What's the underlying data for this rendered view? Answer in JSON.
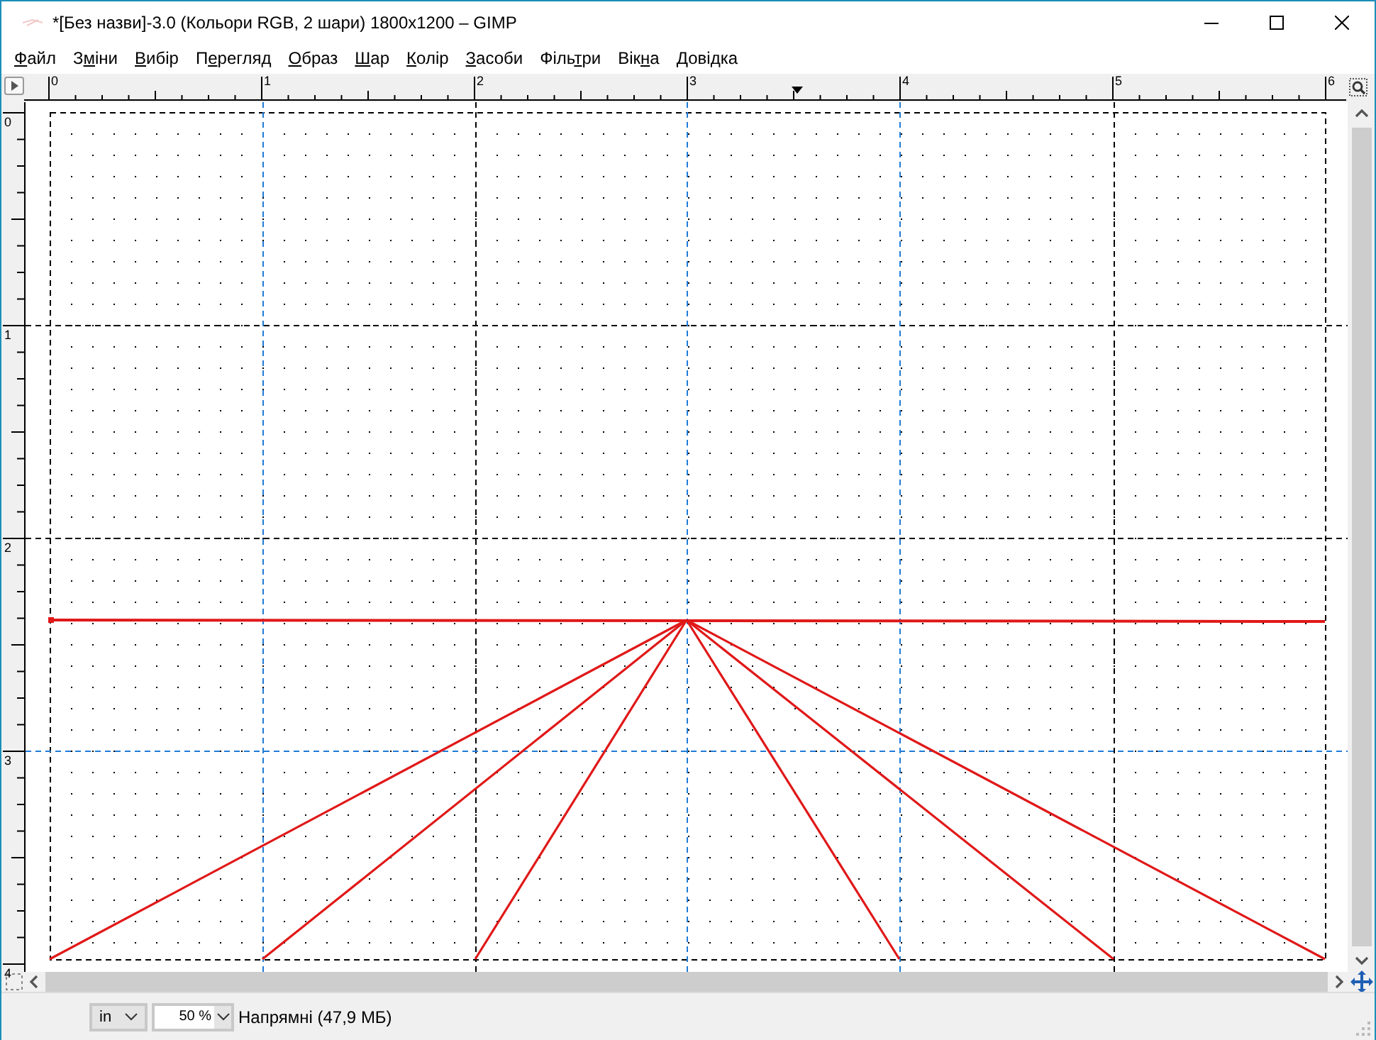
{
  "window": {
    "title": "*[Без назви]-3.0 (Кольори RGB, 2 шари) 1800x1200 – GIMP"
  },
  "menu": [
    {
      "key": "Ф",
      "post": "айл"
    },
    {
      "pre": "З",
      "key": "м",
      "post": "іни"
    },
    {
      "key": "В",
      "post": "ибір"
    },
    {
      "pre": "П",
      "key": "е",
      "post": "регляд"
    },
    {
      "key": "О",
      "post": "браз"
    },
    {
      "key": "Ш",
      "post": "ар"
    },
    {
      "key": "К",
      "post": "олір"
    },
    {
      "key": "З",
      "post": "асоби"
    },
    {
      "pre": "Філь",
      "key": "т",
      "post": "ри"
    },
    {
      "pre": "Вік",
      "key": "н",
      "post": "а"
    },
    {
      "key": "Д",
      "post": "овідка"
    }
  ],
  "top_ruler": {
    "labels": [
      "0",
      "1",
      "2",
      "3",
      "4",
      "5",
      "6"
    ]
  },
  "left_ruler": {
    "labels": [
      "0",
      "1",
      "2",
      "3",
      "4"
    ]
  },
  "status_bar": {
    "unit": "in",
    "zoom": "50 %",
    "message": "Напрямні (47,9 МБ)"
  }
}
